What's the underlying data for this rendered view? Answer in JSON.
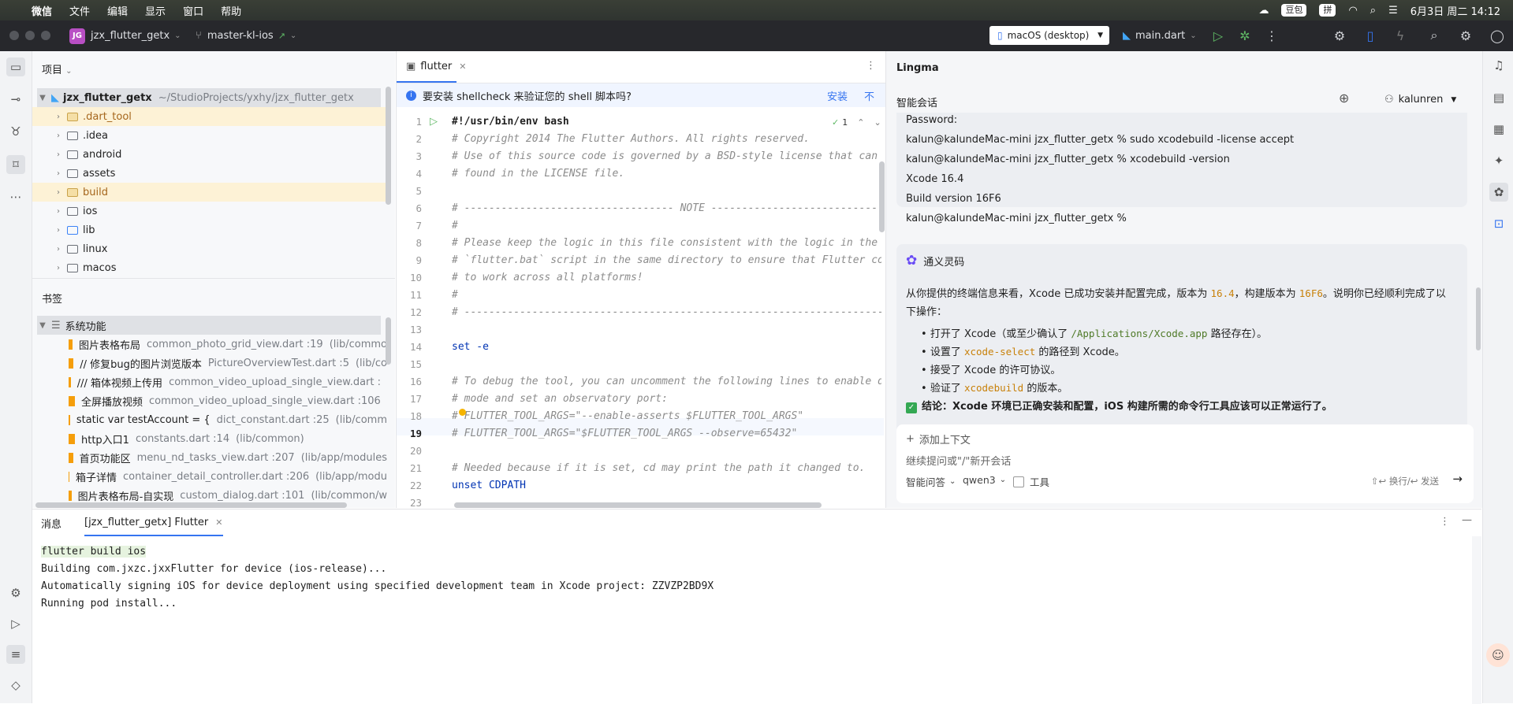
{
  "menubar": {
    "app_name": "微信",
    "menus": [
      "文件",
      "编辑",
      "显示",
      "窗口",
      "帮助"
    ],
    "status_pill_1": "豆包",
    "input_method": "拼",
    "datetime": "6月3日 周二  14:12"
  },
  "toolbar": {
    "project_badge": "JG",
    "project_name": "jzx_flutter_getx",
    "branch": "master-kl-ios",
    "device": "macOS (desktop)",
    "run_config": "main.dart"
  },
  "project": {
    "title": "项目",
    "root_name": "jzx_flutter_getx",
    "root_path": "~/StudioProjects/yxhy/jzx_flutter_getx",
    "folders": [
      ".dart_tool",
      ".idea",
      "android",
      "assets",
      "build",
      "ios",
      "lib",
      "linux",
      "macos"
    ]
  },
  "bookmarks": {
    "title": "书签",
    "group": "系统功能",
    "items": [
      {
        "label": "图片表格布局",
        "file": "common_photo_grid_view.dart :19",
        "path": "(lib/commo"
      },
      {
        "label": "// 修复bug的图片浏览版本",
        "file": "PictureOverviewTest.dart :5",
        "path": "(lib/co"
      },
      {
        "label": "/// 箱体视频上传用",
        "file": "common_video_upload_single_view.dart :",
        "path": ""
      },
      {
        "label": "全屏播放视频",
        "file": "common_video_upload_single_view.dart :106",
        "path": ""
      },
      {
        "label": "static var testAccount = {",
        "file": "dict_constant.dart :25",
        "path": "(lib/comm"
      },
      {
        "label": "http入口1",
        "file": "constants.dart :14",
        "path": "(lib/common)"
      },
      {
        "label": "首页功能区",
        "file": "menu_nd_tasks_view.dart :207",
        "path": "(lib/app/modules"
      },
      {
        "label": "箱子详情",
        "file": "container_detail_controller.dart :206",
        "path": "(lib/app/modu"
      },
      {
        "label": "图片表格布局-自实现",
        "file": "custom_dialog.dart :101",
        "path": "(lib/common/w"
      }
    ]
  },
  "editor": {
    "tab": "flutter",
    "banner_text": "要安装 shellcheck 来验证您的 shell 脚本吗?",
    "banner_install": "安装",
    "banner_no": "不",
    "inspection_count": "1",
    "lines": [
      {
        "n": "1",
        "t": "#!/usr/bin/env bash",
        "s": "b"
      },
      {
        "n": "2",
        "t": "# Copyright 2014 The Flutter Authors. All rights reserved.",
        "s": "c"
      },
      {
        "n": "3",
        "t": "# Use of this source code is governed by a BSD-style license that can b",
        "s": "c"
      },
      {
        "n": "4",
        "t": "# found in the LICENSE file.",
        "s": "c"
      },
      {
        "n": "5",
        "t": "",
        "s": "c"
      },
      {
        "n": "6",
        "t": "# ---------------------------------- NOTE ----------------------------------",
        "s": "c"
      },
      {
        "n": "7",
        "t": "#",
        "s": "c"
      },
      {
        "n": "8",
        "t": "# Please keep the logic in this file consistent with the logic in the",
        "s": "c"
      },
      {
        "n": "9",
        "t": "# `flutter.bat` script in the same directory to ensure that Flutter cor",
        "s": "c"
      },
      {
        "n": "10",
        "t": "# to work across all platforms!",
        "s": "c"
      },
      {
        "n": "11",
        "t": "#",
        "s": "c"
      },
      {
        "n": "12",
        "t": "# ---------------------------------------------------------------------------",
        "s": "c"
      },
      {
        "n": "13",
        "t": "",
        "s": "c"
      },
      {
        "n": "14",
        "t": "set -e",
        "s": "k"
      },
      {
        "n": "15",
        "t": "",
        "s": "c"
      },
      {
        "n": "16",
        "t": "# To debug the tool, you can uncomment the following lines to enable de",
        "s": "c"
      },
      {
        "n": "17",
        "t": "# mode and set an observatory port:",
        "s": "c"
      },
      {
        "n": "18",
        "t": "# FLUTTER_TOOL_ARGS=\"--enable-asserts $FLUTTER_TOOL_ARGS\"",
        "s": "c"
      },
      {
        "n": "19",
        "t": "# FLUTTER_TOOL_ARGS=\"$FLUTTER_TOOL_ARGS --observe=65432\"",
        "s": "c"
      },
      {
        "n": "20",
        "t": "",
        "s": "c"
      },
      {
        "n": "21",
        "t": "# Needed because if it is set, cd may print the path it changed to.",
        "s": "c"
      },
      {
        "n": "22",
        "t": "unset CDPATH",
        "s": "k"
      },
      {
        "n": "23",
        "t": "",
        "s": "c"
      }
    ]
  },
  "lingma": {
    "title": "Lingma",
    "tab": "智能会话",
    "user": "kalunren",
    "terminal_lines": [
      "Password:",
      "kalun@kalundeMac-mini jzx_flutter_getx % sudo xcodebuild -license accept",
      "kalun@kalundeMac-mini jzx_flutter_getx % xcodebuild -version",
      "Xcode 16.4",
      "Build version 16F6",
      "kalun@kalundeMac-mini jzx_flutter_getx %"
    ],
    "bot_name": "通义灵码",
    "answer_p1_a": "从你提供的终端信息来看，Xcode 已成功安装并配置完成，版本为 ",
    "answer_v1": "16.4",
    "answer_p1_b": "，构建版本为 ",
    "answer_v2": "16F6",
    "answer_p1_c": "。说明你已经顺利完成了以",
    "answer_p1_d": "下操作：",
    "b1_a": "打开了 Xcode（或至少确认了 ",
    "b1_code": "/Applications/Xcode.app",
    "b1_b": " 路径存在）。",
    "b2_a": "设置了 ",
    "b2_code": "xcode-select",
    "b2_b": " 的路径到 Xcode。",
    "b3": "接受了 Xcode 的许可协议。",
    "b4_a": "验证了 ",
    "b4_code": "xcodebuild",
    "b4_b": " 的版本。",
    "conclusion_label": "结论：",
    "conclusion": "Xcode 环境已正确安装和配置，iOS 构建所需的命令行工具应该可以正常运行了。",
    "add_context": "添加上下文",
    "input_placeholder": "继续提问或\"/\"新开会话",
    "mode": "智能问答",
    "model": "qwen3",
    "tools": "工具",
    "send_hint": "⇧↩ 换行/↩ 发送"
  },
  "bottom": {
    "tab_messages": "消息",
    "tab_run": "[jzx_flutter_getx] Flutter",
    "lines": [
      "flutter build ios",
      "Building com.jxzc.jxxFlutter for device (ios-release)...",
      "Automatically signing iOS for device deployment using specified development team in Xcode project: ZZVZP2BD9X",
      "Running pod install..."
    ]
  }
}
